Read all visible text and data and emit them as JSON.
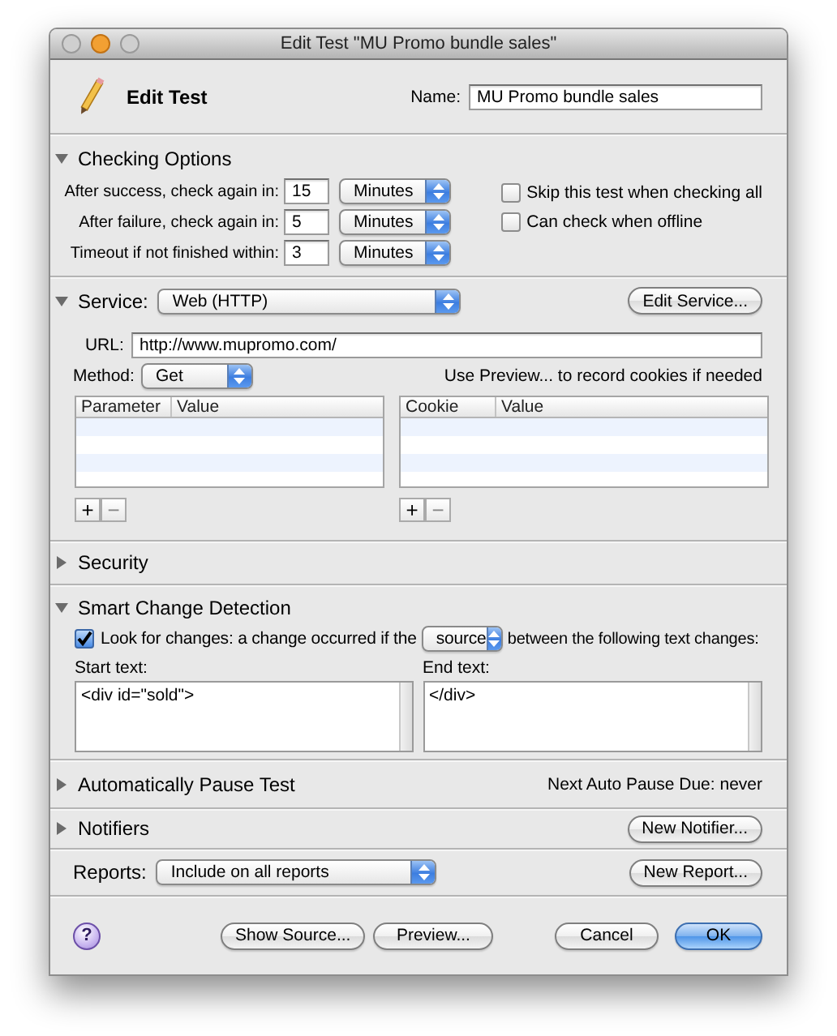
{
  "window": {
    "title": "Edit Test \"MU Promo bundle sales\""
  },
  "header": {
    "title": "Edit Test",
    "name_label": "Name:",
    "name_value": "MU Promo bundle sales"
  },
  "checking_options": {
    "title": "Checking Options",
    "expanded": true,
    "rows": [
      {
        "label": "After success, check again in:",
        "value": "15",
        "unit": "Minutes"
      },
      {
        "label": "After failure, check again in:",
        "value": "5",
        "unit": "Minutes"
      },
      {
        "label": "Timeout if not finished within:",
        "value": "3",
        "unit": "Minutes"
      }
    ],
    "checkboxes": [
      {
        "label": "Skip this test when checking all",
        "checked": false
      },
      {
        "label": "Can check when offline",
        "checked": false
      }
    ]
  },
  "service": {
    "label": "Service:",
    "expanded": true,
    "type": "Web (HTTP)",
    "edit_button": "Edit Service...",
    "url_label": "URL:",
    "url": "http://www.mupromo.com/",
    "method_label": "Method:",
    "method": "Get",
    "cookie_hint": "Use Preview... to record cookies if needed",
    "tables": [
      {
        "columns": [
          "Parameter",
          "Value"
        ],
        "add": "+",
        "remove": "−"
      },
      {
        "columns": [
          "Cookie",
          "Value"
        ],
        "add": "+",
        "remove": "−"
      }
    ]
  },
  "security": {
    "title": "Security",
    "expanded": false
  },
  "smart_change_detection": {
    "title": "Smart Change Detection",
    "expanded": true,
    "look_for_changes": {
      "checked": true,
      "before": "Look for changes: a change occurred if the",
      "mode": "source",
      "after": "between the following text changes:"
    },
    "start_label": "Start text:",
    "start_text": "<div id=\"sold\">",
    "end_label": "End text:",
    "end_text": "</div>"
  },
  "auto_pause": {
    "title": "Automatically Pause Test",
    "expanded": false,
    "next_due": "Next Auto Pause Due: never"
  },
  "notifiers": {
    "title": "Notifiers",
    "expanded": false,
    "button": "New Notifier..."
  },
  "reports": {
    "label": "Reports:",
    "value": "Include on all reports",
    "button": "New Report..."
  },
  "footer": {
    "help": "?",
    "buttons": [
      {
        "label": "Show Source...",
        "kind": "normal"
      },
      {
        "label": "Preview...",
        "kind": "normal"
      },
      {
        "label": "Cancel",
        "kind": "normal"
      },
      {
        "label": "OK",
        "kind": "default"
      }
    ]
  }
}
